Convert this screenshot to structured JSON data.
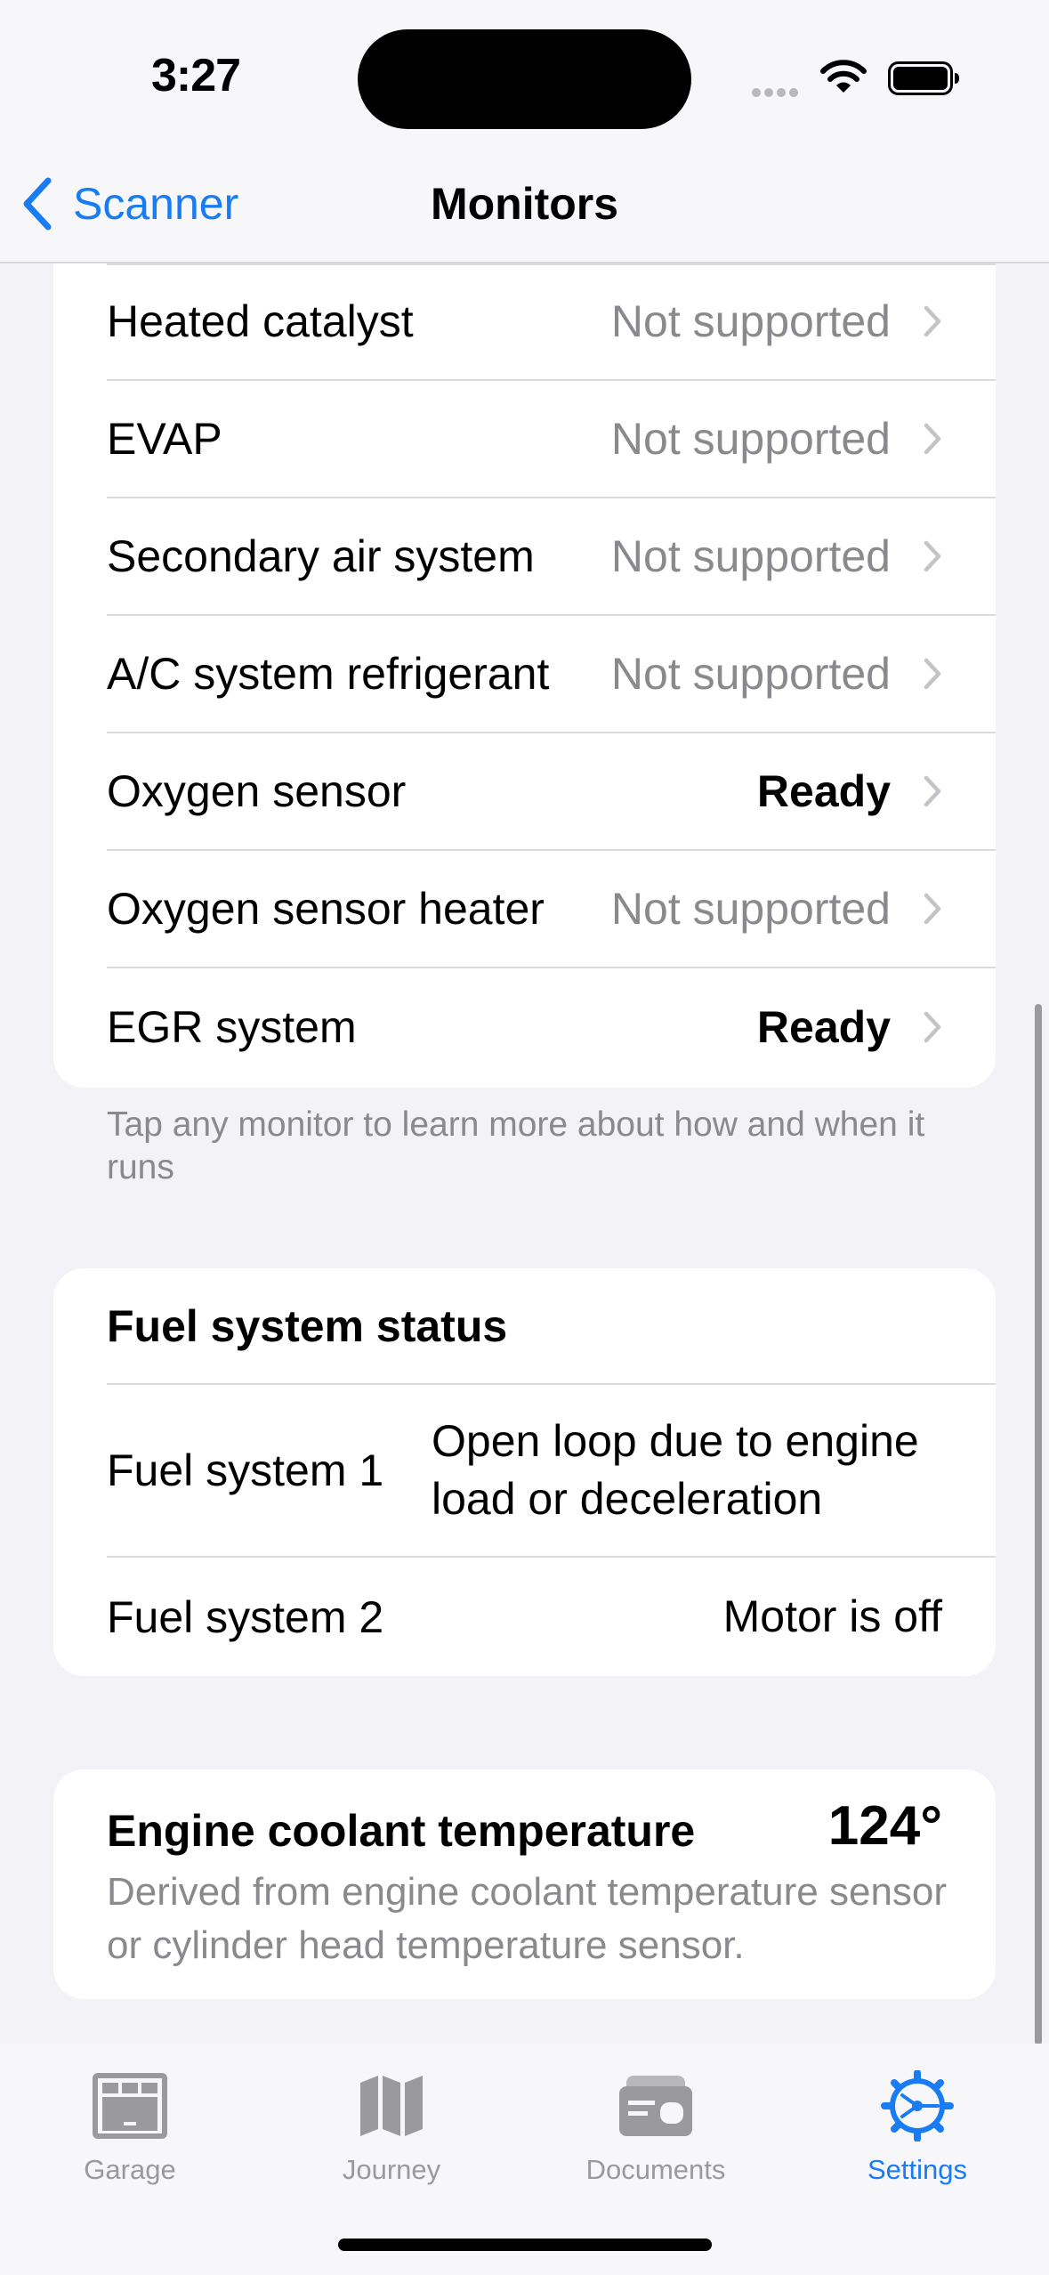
{
  "status_bar": {
    "time": "3:27"
  },
  "nav": {
    "back_label": "Scanner",
    "title": "Monitors"
  },
  "monitors": [
    {
      "label": "Heated catalyst",
      "value": "Not supported",
      "emphasis": false
    },
    {
      "label": "EVAP",
      "value": "Not supported",
      "emphasis": false
    },
    {
      "label": "Secondary air system",
      "value": "Not supported",
      "emphasis": false
    },
    {
      "label": "A/C system refrigerant",
      "value": "Not supported",
      "emphasis": false
    },
    {
      "label": "Oxygen sensor",
      "value": "Ready",
      "emphasis": true
    },
    {
      "label": "Oxygen sensor heater",
      "value": "Not supported",
      "emphasis": false
    },
    {
      "label": "EGR system",
      "value": "Ready",
      "emphasis": true
    }
  ],
  "monitors_footnote": "Tap any monitor to learn more about how and when it runs",
  "fuel_system": {
    "title": "Fuel system status",
    "rows": [
      {
        "label": "Fuel system 1",
        "value": "Open loop due to engine load or deceleration"
      },
      {
        "label": "Fuel system 2",
        "value": "Motor is off"
      }
    ]
  },
  "coolant": {
    "title": "Engine coolant temperature",
    "value": "124°",
    "description": "Derived from engine coolant temperature sensor or cylinder head temperature sensor."
  },
  "tabs": [
    {
      "label": "Garage",
      "icon": "garage-icon",
      "active": false
    },
    {
      "label": "Journey",
      "icon": "map-icon",
      "active": false
    },
    {
      "label": "Documents",
      "icon": "documents-icon",
      "active": false
    },
    {
      "label": "Settings",
      "icon": "gear-icon",
      "active": true
    }
  ],
  "colors": {
    "accent": "#1a7cf2",
    "secondary_text": "#8a8a8e",
    "background": "#f2f2f7"
  }
}
